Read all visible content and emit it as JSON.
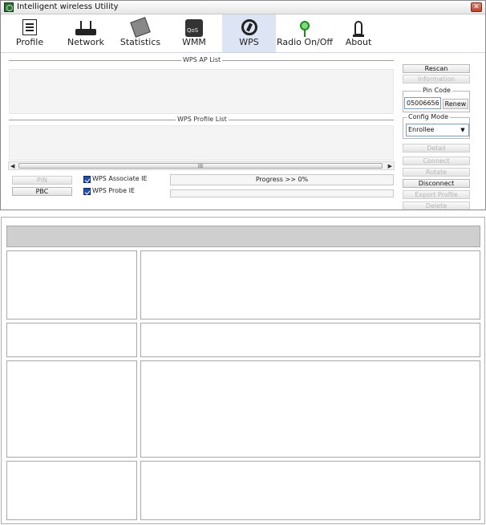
{
  "window": {
    "title": "Intelligent wireless Utility",
    "close_glyph": "✕"
  },
  "toolbar": {
    "items": [
      {
        "label": "Profile",
        "icon": "profile-icon"
      },
      {
        "label": "Network",
        "icon": "network-icon"
      },
      {
        "label": "Statistics",
        "icon": "statistics-icon"
      },
      {
        "label": "WMM",
        "icon": "wmm-icon"
      },
      {
        "label": "WPS",
        "icon": "wps-icon",
        "active": true
      },
      {
        "label": "Radio On/Off",
        "icon": "radio-icon"
      },
      {
        "label": "About",
        "icon": "about-icon"
      }
    ]
  },
  "main": {
    "ap_list_title": "WPS AP List",
    "profile_list_title": "WPS Profile List",
    "scroll_thumb_text": "III",
    "scroll_left": "◀",
    "scroll_right": "▶",
    "pin_button": "PIN",
    "pbc_button": "PBC",
    "associate_ie_label": "WPS Associate IE",
    "probe_ie_label": "WPS Probe IE",
    "progress_text": "Progress >> 0%",
    "progress_value": 0
  },
  "sidebar": {
    "rescan": "Rescan",
    "information": "Information",
    "pin_code_title": "Pin Code",
    "pin_code_value": "05006656",
    "renew": "Renew",
    "config_mode_title": "Config Mode",
    "config_mode_value": "Enrollee",
    "detail": "Detail",
    "connect": "Connect",
    "rotate": "Rotate",
    "disconnect": "Disconnect",
    "export_profile": "Export Profile",
    "delete": "Delete"
  },
  "colors": {
    "active_tab": "#dde5f5",
    "checkbox": "#1f4fa8"
  }
}
